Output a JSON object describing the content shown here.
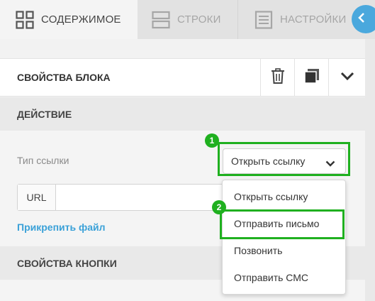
{
  "tabs": {
    "content_label": "СОДЕРЖИМОЕ",
    "rows_label": "СТРОКИ",
    "settings_label": "НАСТРОЙКИ"
  },
  "block": {
    "title": "СВОЙСТВА БЛОКА"
  },
  "action": {
    "section_title": "ДЕЙСТВИЕ",
    "link_type_label": "Тип ссылки",
    "link_type_value": "Открыть ссылку",
    "url_prefix": "URL",
    "url_value": "",
    "attach_file_label": "Прикрепить файл"
  },
  "dropdown": {
    "options": [
      "Открыть ссылку",
      "Отправить письмо",
      "Позвонить",
      "Отправить СМС"
    ]
  },
  "button_props": {
    "section_title": "СВОЙСТВА КНОПКИ"
  },
  "annotations": {
    "badge_1": "1",
    "badge_2": "2"
  },
  "colors": {
    "accent": "#4aa8dd",
    "highlight": "#1fb01f",
    "link": "#3aa1d8"
  }
}
